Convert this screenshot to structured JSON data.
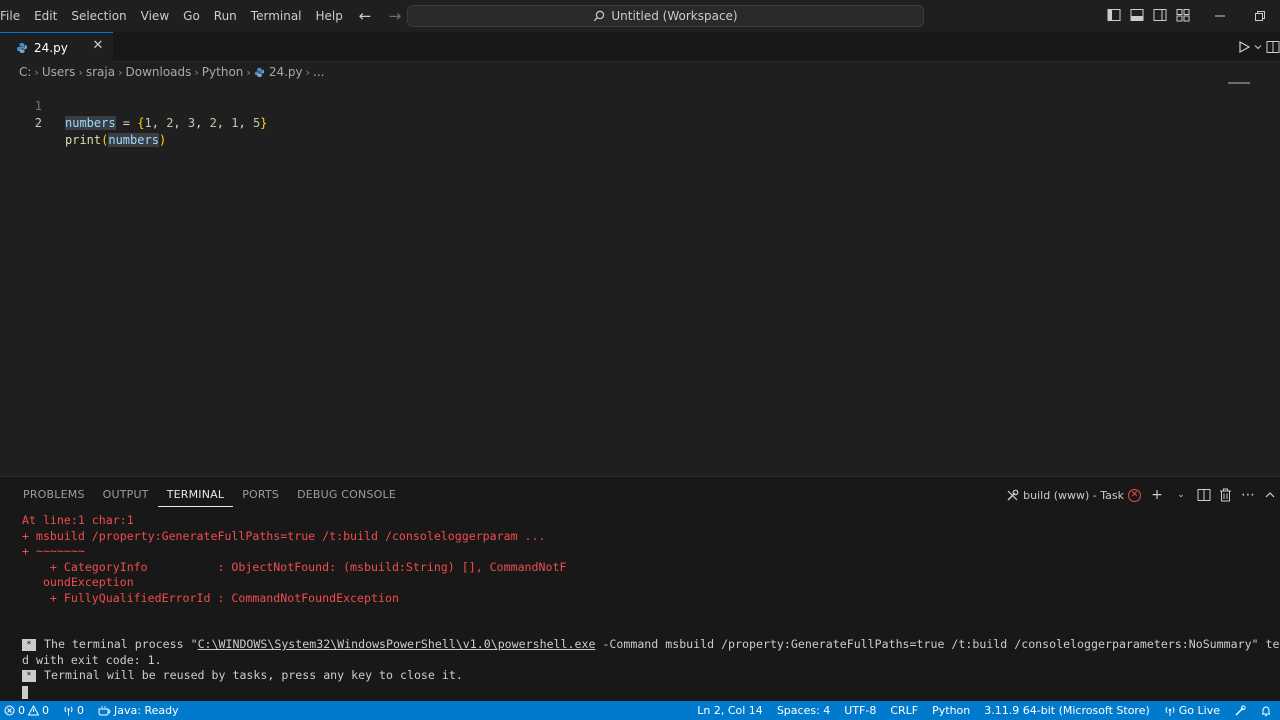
{
  "menu": [
    "File",
    "Edit",
    "Selection",
    "View",
    "Go",
    "Run",
    "Terminal",
    "Help"
  ],
  "command_center": {
    "label": "Untitled (Workspace)"
  },
  "tab": {
    "filename": "24.py"
  },
  "breadcrumb": [
    "C:",
    "Users",
    "sraja",
    "Downloads",
    "Python",
    "24.py",
    "..."
  ],
  "editor": {
    "lines": [
      {
        "number": "1",
        "tokens": [
          {
            "t": "numbers",
            "c": "var hl"
          },
          {
            "t": " = ",
            "c": ""
          },
          {
            "t": "{",
            "c": "p"
          },
          {
            "t": "1",
            "c": "num"
          },
          {
            "t": ", ",
            "c": ""
          },
          {
            "t": "2",
            "c": "num"
          },
          {
            "t": ", ",
            "c": ""
          },
          {
            "t": "3",
            "c": "num"
          },
          {
            "t": ", ",
            "c": ""
          },
          {
            "t": "2",
            "c": "num"
          },
          {
            "t": ", ",
            "c": ""
          },
          {
            "t": "1",
            "c": "num"
          },
          {
            "t": ", ",
            "c": ""
          },
          {
            "t": "5",
            "c": "num"
          },
          {
            "t": "}",
            "c": "p"
          }
        ]
      },
      {
        "number": "2",
        "tokens": [
          {
            "t": "print",
            "c": "fn"
          },
          {
            "t": "(",
            "c": "p"
          },
          {
            "t": "numbers",
            "c": "var hl"
          },
          {
            "t": ")",
            "c": "p"
          }
        ]
      }
    ]
  },
  "panel": {
    "tabs": [
      "PROBLEMS",
      "OUTPUT",
      "TERMINAL",
      "PORTS",
      "DEBUG CONSOLE"
    ],
    "active_tab": "TERMINAL",
    "task_label": "build (www) - Task"
  },
  "terminal": {
    "error_lines": [
      "At line:1 char:1",
      "+ msbuild /property:GenerateFullPaths=true /t:build /consoleloggerparam ...",
      "+ ~~~~~~~",
      "    + CategoryInfo          : ObjectNotFound: (msbuild:String) [], CommandNotF",
      "   oundException",
      "    + FullyQualifiedErrorId : CommandNotFoundException"
    ],
    "process_prefix": "The terminal process \"",
    "process_path": "C:\\WINDOWS\\System32\\WindowsPowerShell\\v1.0\\powershell.exe",
    "process_suffix": " -Command msbuild /property:GenerateFullPaths=true /t:build /consoleloggerparameters:NoSummary\" terminate",
    "process_line2": "d with exit code: 1.",
    "reuse_message": "Terminal will be reused by tasks, press any key to close it."
  },
  "statusbar": {
    "errors": "0",
    "warnings": "0",
    "ports": "0",
    "java": "Java: Ready",
    "position": "Ln 2, Col 14",
    "spaces": "Spaces: 4",
    "encoding": "UTF-8",
    "eol": "CRLF",
    "language": "Python",
    "interpreter": "3.11.9 64-bit (Microsoft Store)",
    "go_live": "Go Live"
  },
  "colors": {
    "accent": "#007acc",
    "error": "#f14c4c",
    "background": "#1f1f1f"
  },
  "icons": [
    "back-arrow-icon",
    "forward-arrow-icon",
    "search-icon",
    "python-file-icon",
    "close-icon",
    "run-icon",
    "split-editor-icon",
    "tools-icon",
    "error-circle-icon",
    "plus-icon",
    "chevron-down-icon",
    "trash-icon",
    "more-icon",
    "chevron-up-icon",
    "error-icon",
    "warning-icon",
    "radio-tower-icon",
    "java-icon",
    "broadcast-icon",
    "feedback-icon"
  ]
}
